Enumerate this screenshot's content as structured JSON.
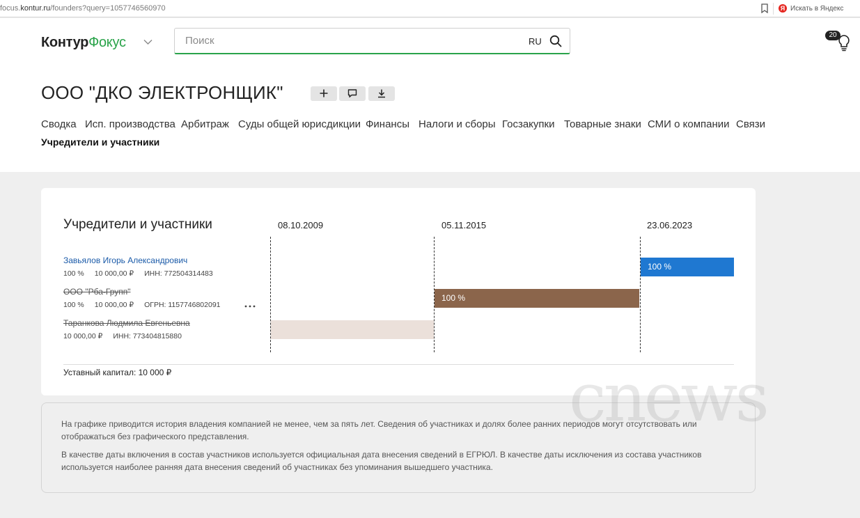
{
  "browser": {
    "url_prefix": "focus.",
    "url_domain": "kontur.ru",
    "url_path": "/founders?query=1057746560970",
    "yandex_search_label": "Искать в Яндекс"
  },
  "header": {
    "logo_part1": "Контур",
    "logo_part2": "Фокус",
    "search_placeholder": "Поиск",
    "search_lang": "RU",
    "notifications_count": "20"
  },
  "company": {
    "title": "ООО \"ДКО ЭЛЕКТРОНЩИК\""
  },
  "tabs": [
    {
      "label": "Сводка"
    },
    {
      "label": "Исп. производства"
    },
    {
      "label": "Арбитраж"
    },
    {
      "label": "Суды общей юрисдикции"
    },
    {
      "label": "Финансы"
    },
    {
      "label": "Налоги и сборы"
    },
    {
      "label": "Госзакупки"
    },
    {
      "label": "Товарные знаки"
    },
    {
      "label": "СМИ о компании"
    },
    {
      "label": "Связи"
    },
    {
      "label": "Учредители и участники",
      "active": true
    }
  ],
  "founders": {
    "title": "Учредители и участники",
    "dates": [
      "08.10.2009",
      "05.11.2015",
      "23.06.2023"
    ],
    "participants": [
      {
        "name": "Завьялов Игорь Александрович",
        "share": "100 %",
        "capital": "10 000,00 ₽",
        "id": "ИНН: 772504314483",
        "struck": false,
        "bar_label": "100 %"
      },
      {
        "name": "ООО \"Рба-Групп\"",
        "share": "100 %",
        "capital": "10 000,00 ₽",
        "id": "ОГРН: 1157746802091",
        "struck": true,
        "bar_label": "100 %"
      },
      {
        "name": "Таранкова Людмила Евгеньевна",
        "capital": "10 000,00 ₽",
        "id": "ИНН: 773404815880",
        "struck": true
      }
    ],
    "charter_capital": "Уставный капитал: 10 000 ₽"
  },
  "info": {
    "p1": "На графике приводится история владения компанией не менее, чем за пять лет. Сведения об участниках и долях более ранних периодов могут отсутствовать или отображаться без графического представления.",
    "p2": "В качестве даты включения в состав участников используется официальная дата внесения сведений в ЕГРЮЛ. В качестве даты исключения из состава участников используется наиболее ранняя дата внесения сведений об участниках без упоминания вышедшего участника."
  },
  "watermark": "cnews",
  "colors": {
    "brand_green": "#2aa34a",
    "link_blue": "#1a5aa8",
    "bar_blue": "#1f78d1",
    "bar_brown": "#8b654b",
    "bar_pale": "#ebe0da"
  }
}
